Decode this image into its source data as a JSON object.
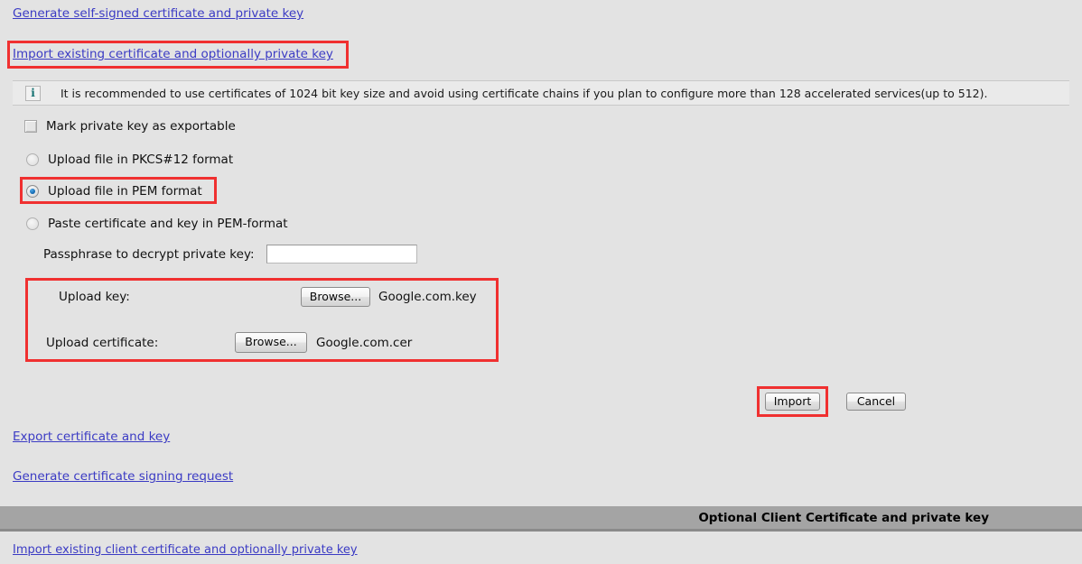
{
  "links": {
    "generate_self_signed": "Generate self-signed certificate and private key ",
    "import_existing": "Import existing certificate and optionally private key",
    "export_cert_key": "Export certificate and key",
    "generate_csr": "Generate certificate signing request",
    "import_client_cert": "Import existing client certificate and optionally private key"
  },
  "info": {
    "icon": "info-icon",
    "glyph": "i",
    "text": "It is recommended to use certificates of 1024 bit key size and avoid using certificate chains if you plan to configure more than 128 accelerated services(up to 512)."
  },
  "options": {
    "mark_exportable": {
      "label": "Mark private key as exportable",
      "checked": false
    },
    "format_group": [
      {
        "label": "Upload file in PKCS#12 format",
        "selected": false
      },
      {
        "label": "Upload file in PEM format",
        "selected": true
      },
      {
        "label": "Paste certificate and key in PEM-format",
        "selected": false
      }
    ]
  },
  "passphrase": {
    "label": "Passphrase to decrypt private key:",
    "value": "",
    "placeholder": ""
  },
  "upload": {
    "key": {
      "label": "Upload key:",
      "browse_label": "Browse...",
      "filename": "Google.com.key"
    },
    "certificate": {
      "label": "Upload certificate:",
      "browse_label": "Browse...",
      "filename": "Google.com.cer"
    }
  },
  "actions": {
    "import_label": "Import",
    "cancel_label": "Cancel"
  },
  "section": {
    "title": "Optional Client Certificate and private key"
  },
  "colors": {
    "page_background": "#e3e3e3",
    "link": "#3b3bc4",
    "highlight": "#f03030",
    "info_background": "#eaeaea",
    "info_icon": "#137070",
    "section_bar": "#a4a4a4",
    "radio_selected": "#0a5fa8"
  }
}
